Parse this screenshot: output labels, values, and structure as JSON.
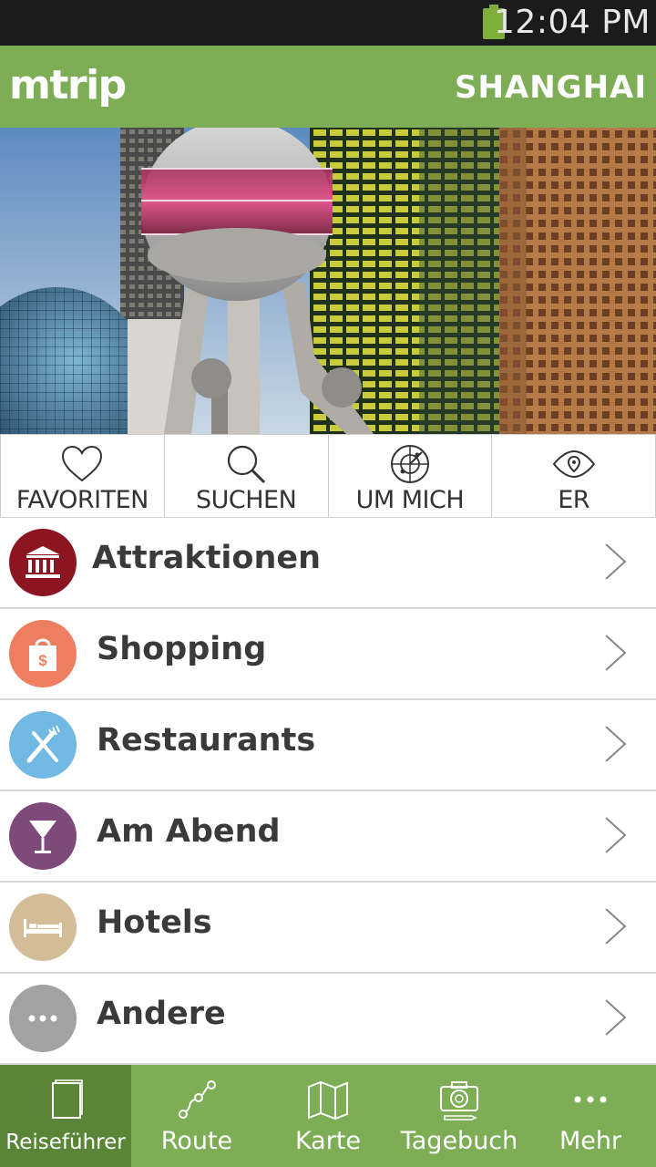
{
  "status_bar": {
    "time": "12:04 PM"
  },
  "header": {
    "logo": "mtrip",
    "city": "SHANGHAI"
  },
  "hero": {
    "image": "shanghai-skyline-photo"
  },
  "quick_actions": [
    {
      "label": "FAVORITEN",
      "icon": "heart-icon"
    },
    {
      "label": "SUCHEN",
      "icon": "search-icon"
    },
    {
      "label": "UM MICH",
      "icon": "radar-icon"
    },
    {
      "label": "ER",
      "icon": "eye-icon"
    }
  ],
  "categories": [
    {
      "label": "Attraktionen",
      "icon": "museum-icon",
      "color": "#8c1522"
    },
    {
      "label": "Shopping",
      "icon": "shopping-bag-icon",
      "color": "#ee7e60"
    },
    {
      "label": "Restaurants",
      "icon": "cutlery-icon",
      "color": "#71b9e3"
    },
    {
      "label": "Am Abend",
      "icon": "cocktail-icon",
      "color": "#7d4a79"
    },
    {
      "label": "Hotels",
      "icon": "bed-icon",
      "color": "#d3bd99"
    },
    {
      "label": "Andere",
      "icon": "more-icon",
      "color": "#a2a2a2"
    }
  ],
  "tabs": [
    {
      "label": "Reiseführer",
      "icon": "guidebook-icon",
      "active": true
    },
    {
      "label": "Route",
      "icon": "route-icon",
      "active": false
    },
    {
      "label": "Karte",
      "icon": "map-icon",
      "active": false
    },
    {
      "label": "Tagebuch",
      "icon": "camera-icon",
      "active": false
    },
    {
      "label": "Mehr",
      "icon": "more-dots-icon",
      "active": false
    }
  ],
  "colors": {
    "brand_green": "#7dad55",
    "active_tab": "#5a8436",
    "status_bar": "#1b1b1b",
    "battery": "#7fae3a"
  }
}
